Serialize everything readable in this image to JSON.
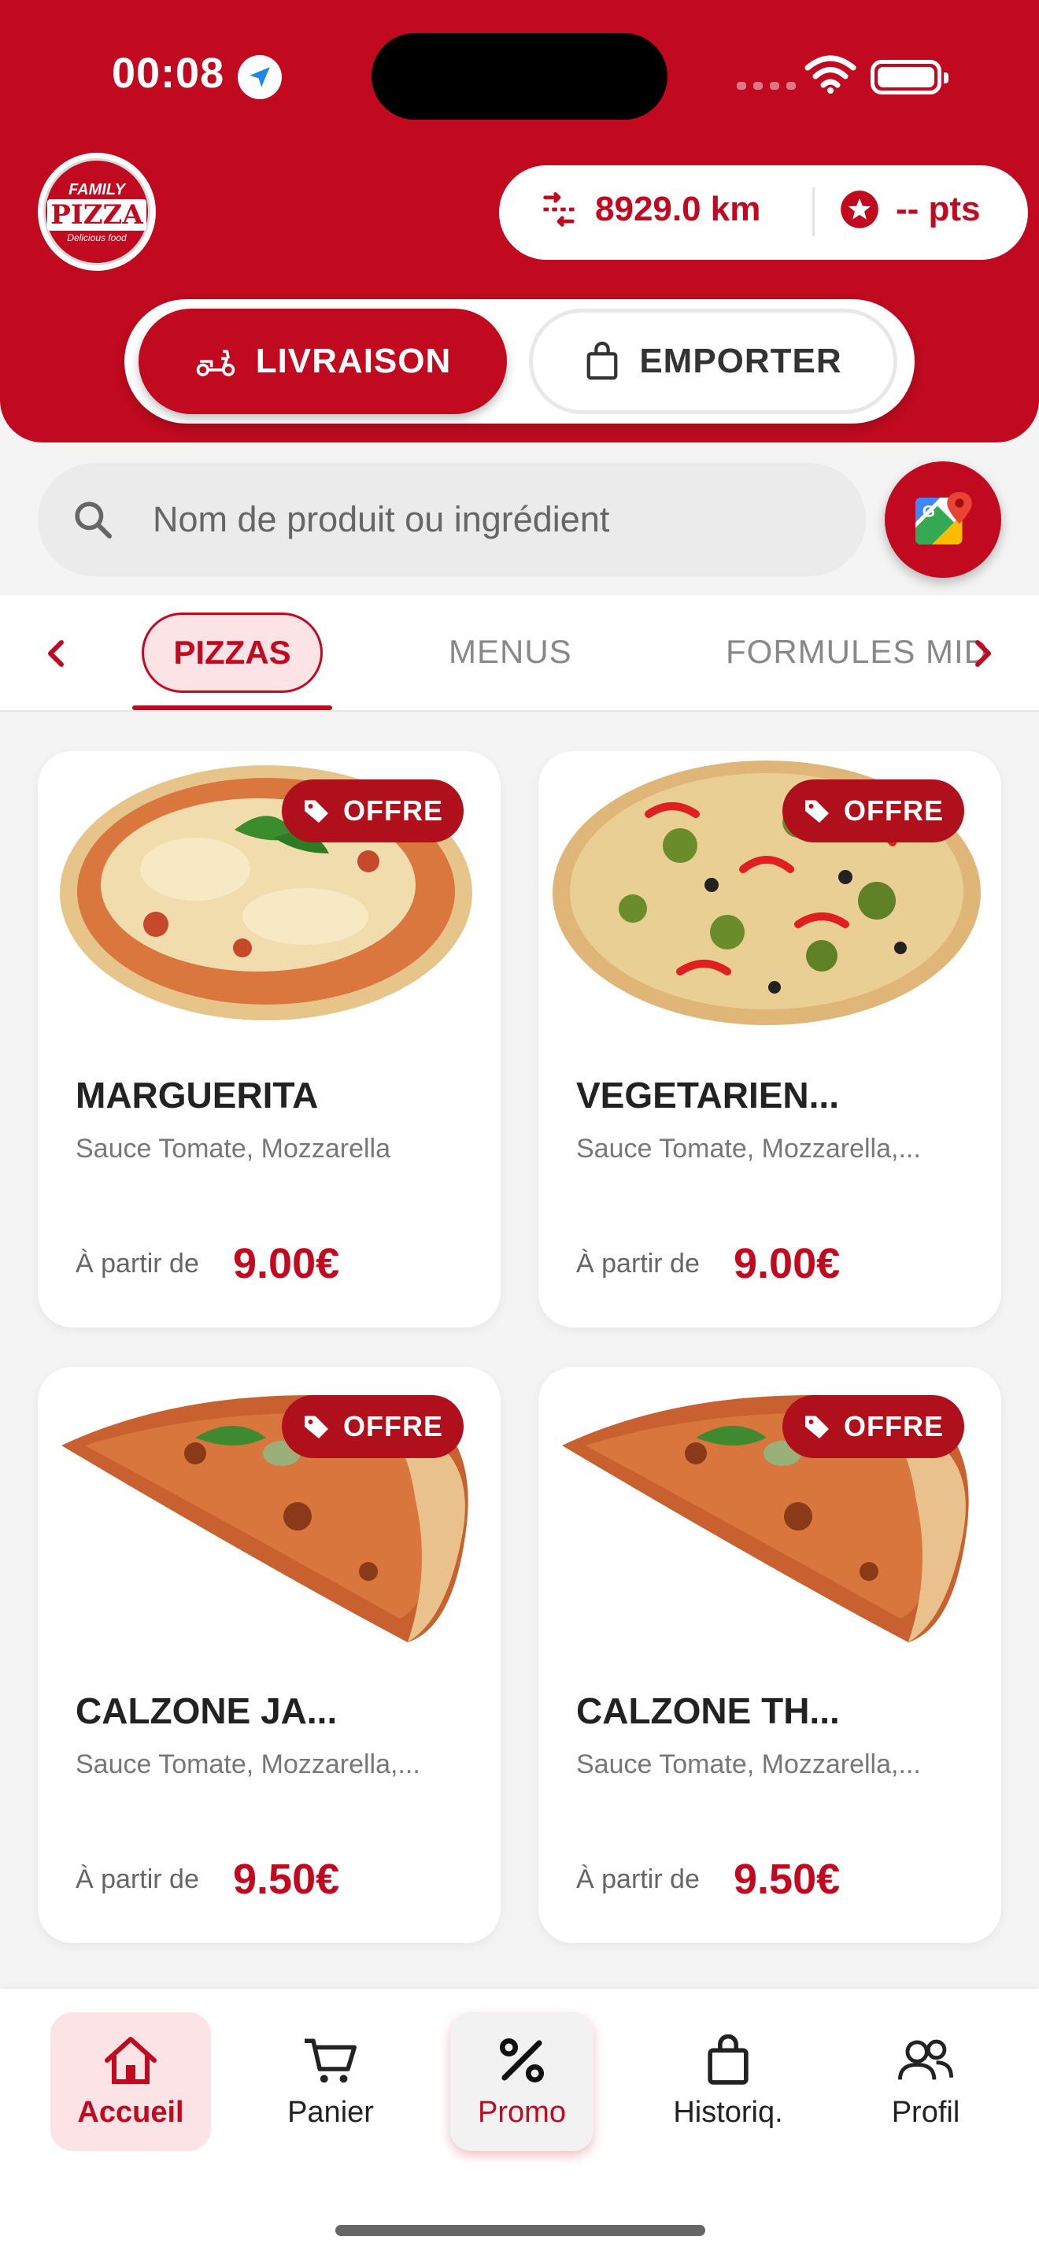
{
  "status_bar": {
    "time": "00:08"
  },
  "header": {
    "logo": {
      "top": "FAMILY",
      "main": "PIZZA",
      "sub": "Delicious food"
    },
    "distance": "8929.0 km",
    "points": "-- pts",
    "modes": [
      {
        "label": "LIVRAISON",
        "icon": "scooter-icon",
        "active": true
      },
      {
        "label": "EMPORTER",
        "icon": "shopping-bag-icon",
        "active": false
      }
    ]
  },
  "search": {
    "placeholder": "Nom de produit ou ingrédient",
    "maps_icon": "google-maps-icon"
  },
  "tabs": [
    {
      "label": "PIZZAS",
      "active": true
    },
    {
      "label": "MENUS",
      "active": false
    },
    {
      "label": "FORMULES MID",
      "active": false
    }
  ],
  "products": [
    {
      "name": "MARGUERITA",
      "desc": "Sauce Tomate, Mozzarella",
      "from": "À partir de",
      "price": "9.00€",
      "badge": "OFFRE"
    },
    {
      "name": "VEGETARIEN...",
      "desc": "Sauce Tomate, Mozzarella,...",
      "from": "À partir de",
      "price": "9.00€",
      "badge": "OFFRE"
    },
    {
      "name": "CALZONE JA...",
      "desc": "Sauce Tomate, Mozzarella,...",
      "from": "À partir de",
      "price": "9.50€",
      "badge": "OFFRE"
    },
    {
      "name": "CALZONE TH...",
      "desc": "Sauce Tomate, Mozzarella,...",
      "from": "À partir de",
      "price": "9.50€",
      "badge": "OFFRE"
    }
  ],
  "bottom_nav": [
    {
      "label": "Accueil",
      "icon": "home-icon",
      "active": true
    },
    {
      "label": "Panier",
      "icon": "cart-icon",
      "active": false
    },
    {
      "label": "Promo",
      "icon": "percent-icon",
      "active": false
    },
    {
      "label": "Historiq.",
      "icon": "shopping-bag-icon",
      "active": false
    },
    {
      "label": "Profil",
      "icon": "users-icon",
      "active": false
    }
  ],
  "colors": {
    "brand": "#c10a1f",
    "badge": "#b0101b",
    "active_tab_bg": "#fbe3e6"
  }
}
